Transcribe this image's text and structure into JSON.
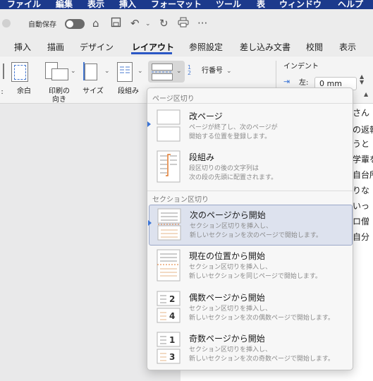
{
  "menubar": {
    "items": [
      "ファイル",
      "編集",
      "表示",
      "挿入",
      "フォーマット",
      "ツール",
      "表",
      "ウィンドウ",
      "ヘルプ"
    ]
  },
  "titlebar": {
    "autosave_label": "自動保存",
    "more_label": "···"
  },
  "ribbon_tabs": [
    "挿入",
    "描画",
    "デザイン",
    "レイアウト",
    "参照設定",
    "差し込み文書",
    "校閲",
    "表示"
  ],
  "active_tab": "レイアウト",
  "ribbon": {
    "margins": "余白",
    "orientation_1": "印刷の",
    "orientation_2": "向き",
    "size": "サイズ",
    "columns": "段組み",
    "line_numbers": "行番号",
    "indent_label": "インデント",
    "indent_left_label": "左:",
    "indent_left_value": "0 mm"
  },
  "document_fragments": [
    "さん",
    "の返報",
    "うと",
    "学輩を",
    "自台所",
    "りな",
    "いっ",
    "ロ僧",
    "自分"
  ],
  "breaks_menu": {
    "page_breaks_header": "ページ区切り",
    "section_breaks_header": "セクション区切り",
    "items": [
      {
        "title": "改ページ",
        "desc1": "ページが終了し、次のページが",
        "desc2": "開始する位置を登録します。",
        "selected": false,
        "marker": true
      },
      {
        "title": "段組み",
        "desc1": "段区切りの後の文字列は",
        "desc2": "次の段の先頭に配置されます。",
        "selected": false,
        "marker": false
      },
      {
        "title": "次のページから開始",
        "desc1": "セクション区切りを挿入し、",
        "desc2": "新しいセクションを次のページで開始します。",
        "selected": true,
        "marker": true
      },
      {
        "title": "現在の位置から開始",
        "desc1": "セクション区切りを挿入し、",
        "desc2": "新しいセクションを同じページで開始します。",
        "selected": false,
        "marker": false
      },
      {
        "title": "偶数ページから開始",
        "desc1": "セクション区切りを挿入し、",
        "desc2": "新しいセクションを次の偶数ページで開始します。",
        "selected": false,
        "marker": false,
        "icon_top": "2",
        "icon_bottom": "4"
      },
      {
        "title": "奇数ページから開始",
        "desc1": "セクション区切りを挿入し、",
        "desc2": "新しいセクションを次の奇数ページで開始します。",
        "selected": false,
        "marker": false,
        "icon_top": "1",
        "icon_bottom": "3"
      }
    ]
  },
  "colors": {
    "menubar": "#1c3a8c",
    "accent": "#2b57c5",
    "selected_bg": "#dde2ee"
  }
}
